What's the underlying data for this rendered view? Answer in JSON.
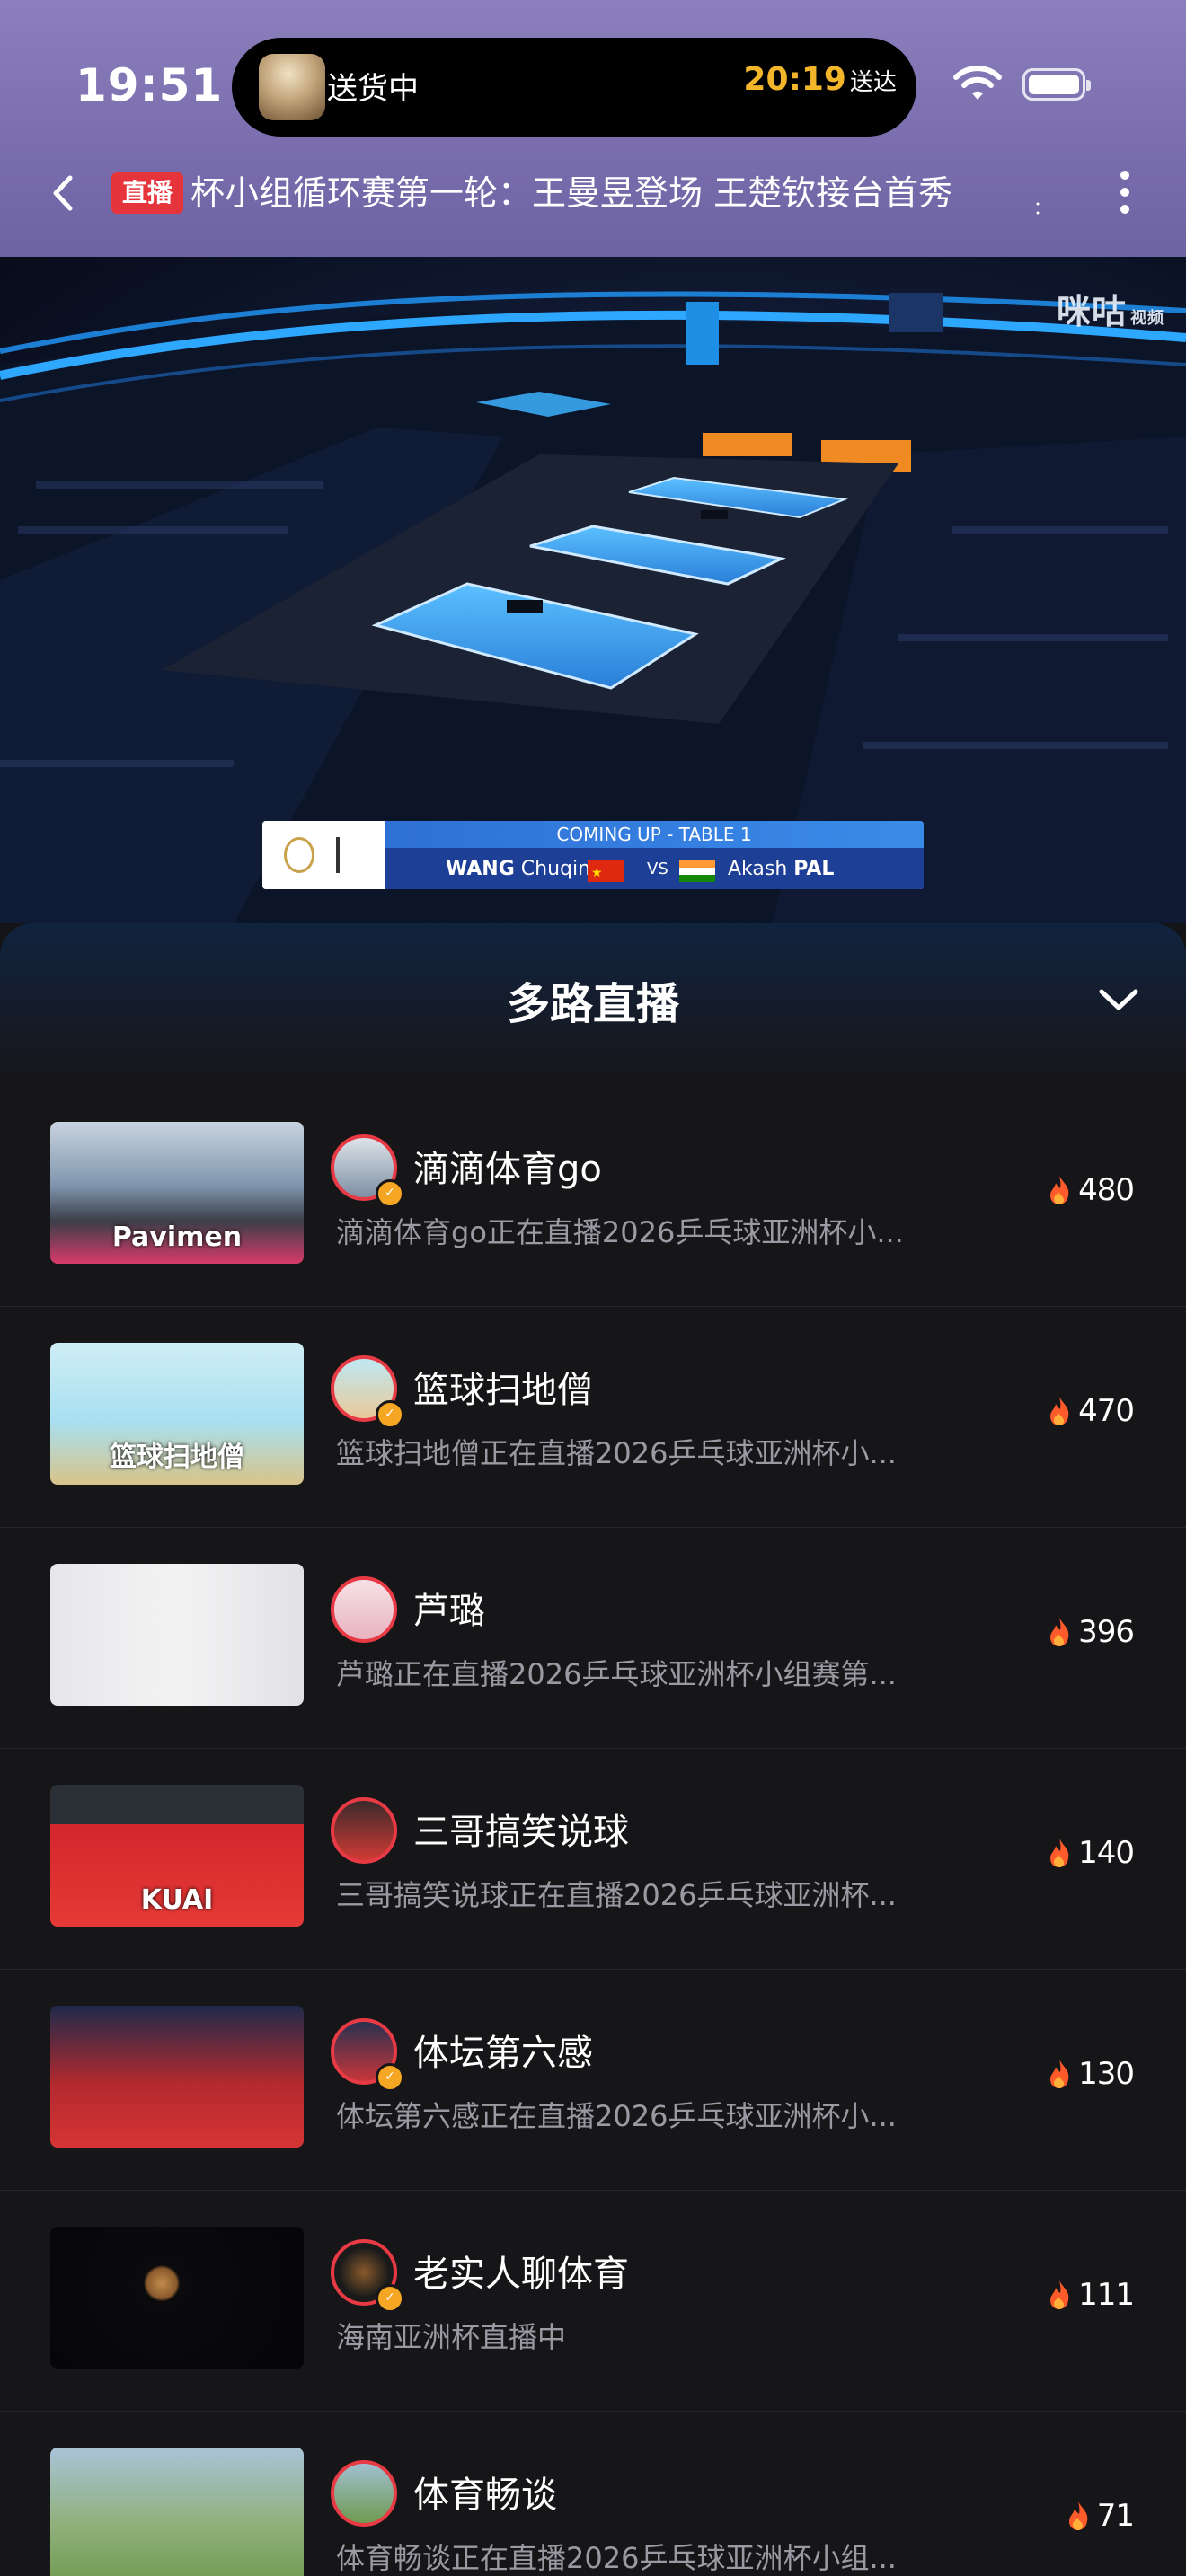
{
  "status_bar": {
    "time": "19:51",
    "island_text": "送货中",
    "island_eta": "20:19",
    "island_eta_suffix": "送达"
  },
  "header": {
    "live_badge": "直播",
    "title": "杯小组循环赛第一轮：王曼昱登场 王楚钦接台首秀",
    "title_fade": "：",
    "back_icon": "chevron-left-icon",
    "more_icon": "more-vertical-icon"
  },
  "video": {
    "watermark": "咪咕",
    "watermark_sub": "视频",
    "lower_third": {
      "heading": "COMING UP - TABLE 1",
      "player1_first": "WANG",
      "player1_last": "Chuqin",
      "vs": "VS",
      "player2_first": "Akash",
      "player2_last": "PAL"
    }
  },
  "panel": {
    "title": "多路直播",
    "collapse_icon": "chevron-down-icon",
    "streams": [
      {
        "name": "滴滴体育go",
        "desc": "滴滴体育go正在直播2026乒乓球亚洲杯小...",
        "heat": "480",
        "verified": true,
        "thumb_text": "Pavimen"
      },
      {
        "name": "篮球扫地僧",
        "desc": "篮球扫地僧正在直播2026乒乓球亚洲杯小...",
        "heat": "470",
        "verified": true,
        "thumb_text": "篮球扫地僧"
      },
      {
        "name": "芦璐",
        "desc": "芦璐正在直播2026乒乓球亚洲杯小组赛第...",
        "heat": "396",
        "verified": false,
        "thumb_text": ""
      },
      {
        "name": "三哥搞笑说球",
        "desc": "三哥搞笑说球正在直播2026乒乓球亚洲杯...",
        "heat": "140",
        "verified": false,
        "thumb_text": "KUAI"
      },
      {
        "name": "体坛第六感",
        "desc": "体坛第六感正在直播2026乒乓球亚洲杯小...",
        "heat": "130",
        "verified": true,
        "thumb_text": ""
      },
      {
        "name": "老实人聊体育",
        "desc": "海南亚洲杯直播中",
        "heat": "111",
        "verified": true,
        "thumb_text": ""
      },
      {
        "name": "体育畅谈",
        "desc": "体育畅谈正在直播2026乒乓球亚洲杯小组...",
        "heat": "71",
        "verified": false,
        "thumb_text": ""
      }
    ]
  },
  "colors": {
    "header_bg": "#7a6eae",
    "live_red": "#e5343c",
    "eta_yellow": "#f3b529",
    "panel_bg": "#161619",
    "avatar_ring": "#e83a44",
    "flame": "#ff5a2a",
    "verified": "#f5a623"
  }
}
